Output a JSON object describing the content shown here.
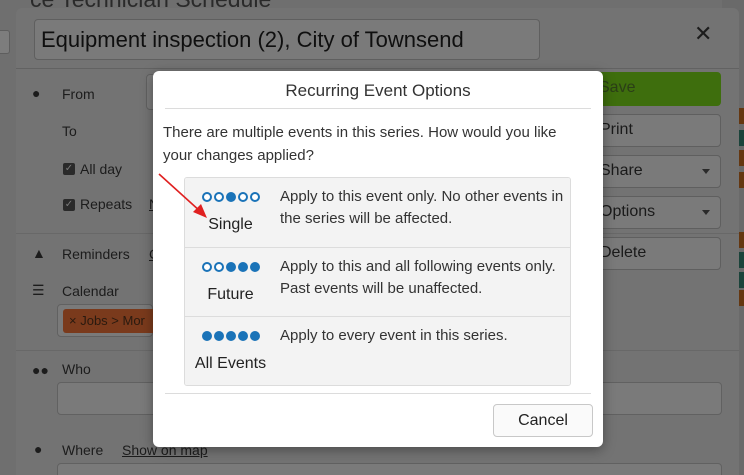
{
  "background": {
    "page_title": "ce Technician Schedule",
    "event_title": "Equipment inspection (2), City of Townsend",
    "fields": {
      "from_label": "From",
      "to_label": "To",
      "all_day_label": "All day",
      "repeats_label": "Repeats",
      "repeats_link": "N",
      "reminders_label": "Reminders",
      "reminders_link": "C",
      "calendar_label": "Calendar",
      "calendar_tag": "Jobs > Mor",
      "who_label": "Who",
      "where_label": "Where",
      "where_link": "Show on map"
    },
    "actions": {
      "save": "Save",
      "print": "Print",
      "share": "Share",
      "options": "Options",
      "delete": "Delete"
    },
    "right_edge_tags": [
      "#b8641e",
      "#2f7a6a",
      "#b8641e",
      "#b8641e",
      "#b8641e",
      "#2f7a6a",
      "#2f7a6a",
      "#b8641e"
    ]
  },
  "dialog": {
    "title": "Recurring Event Options",
    "message": "There are multiple events in this series. How would you like your changes applied?",
    "options": [
      {
        "name": "Single",
        "description": "Apply to this event only. No other events in the series will be affected.",
        "dots": [
          false,
          false,
          true,
          false,
          false
        ]
      },
      {
        "name": "Future",
        "description": "Apply to this and all following events only. Past events will be unaffected.",
        "dots": [
          false,
          false,
          true,
          true,
          true
        ]
      },
      {
        "name": "All Events",
        "description": "Apply to every event in this series.",
        "dots": [
          true,
          true,
          true,
          true,
          true
        ]
      }
    ],
    "cancel_label": "Cancel"
  },
  "colors": {
    "accent_blue": "#1a73b8",
    "save_green": "#5aa51f",
    "annotation_red": "#e02020"
  }
}
